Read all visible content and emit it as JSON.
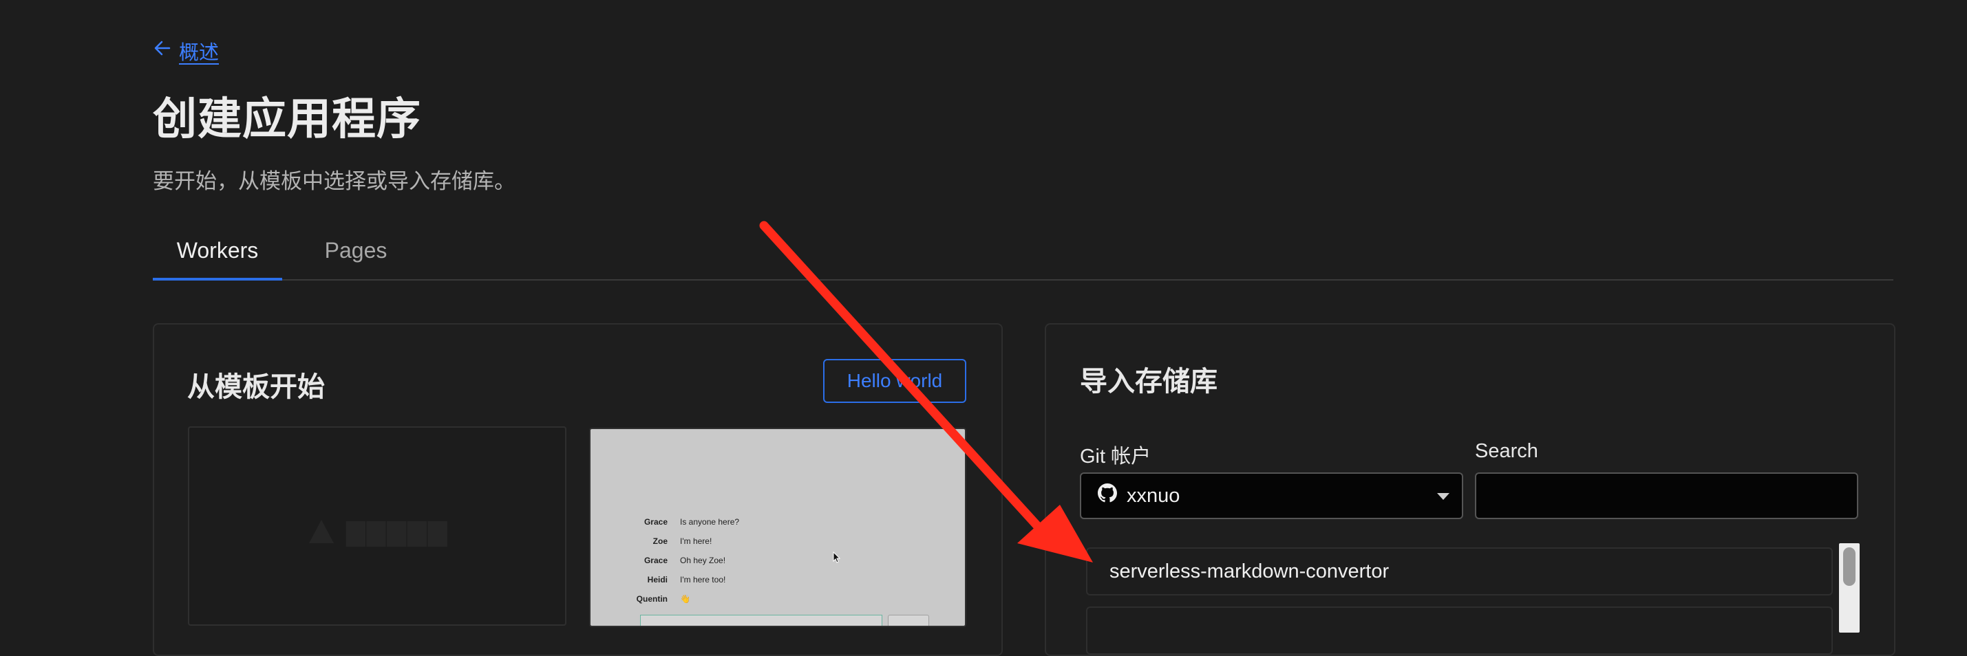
{
  "header": {
    "back_link": "概述",
    "title": "创建应用程序",
    "subtitle": "要开始，从模板中选择或导入存储库。"
  },
  "tabs": [
    {
      "label": "Workers",
      "active": true
    },
    {
      "label": "Pages",
      "active": false
    }
  ],
  "template_panel": {
    "title": "从模板开始",
    "hello_world_button": "Hello world",
    "chat_preview": [
      {
        "name": "Grace",
        "message": "Is anyone here?"
      },
      {
        "name": "Zoe",
        "message": "I'm here!"
      },
      {
        "name": "Grace",
        "message": "Oh hey Zoe!"
      },
      {
        "name": "Heidi",
        "message": "I'm here too!"
      },
      {
        "name": "Quentin",
        "message": "👋"
      }
    ]
  },
  "import_panel": {
    "title": "导入存储库",
    "git_account_label": "Git 帐户",
    "git_account_value": "xxnuo",
    "search_label": "Search",
    "search_value": "",
    "repos": [
      "serverless-markdown-convertor"
    ]
  },
  "colors": {
    "background": "#1d1d1d",
    "accent": "#2b6ee8",
    "link": "#3d7fff",
    "annotation_arrow": "#ff2a1a"
  },
  "icons": {
    "back": "arrow-left-icon",
    "git_provider": "github-icon",
    "dropdown": "chevron-down-icon"
  }
}
